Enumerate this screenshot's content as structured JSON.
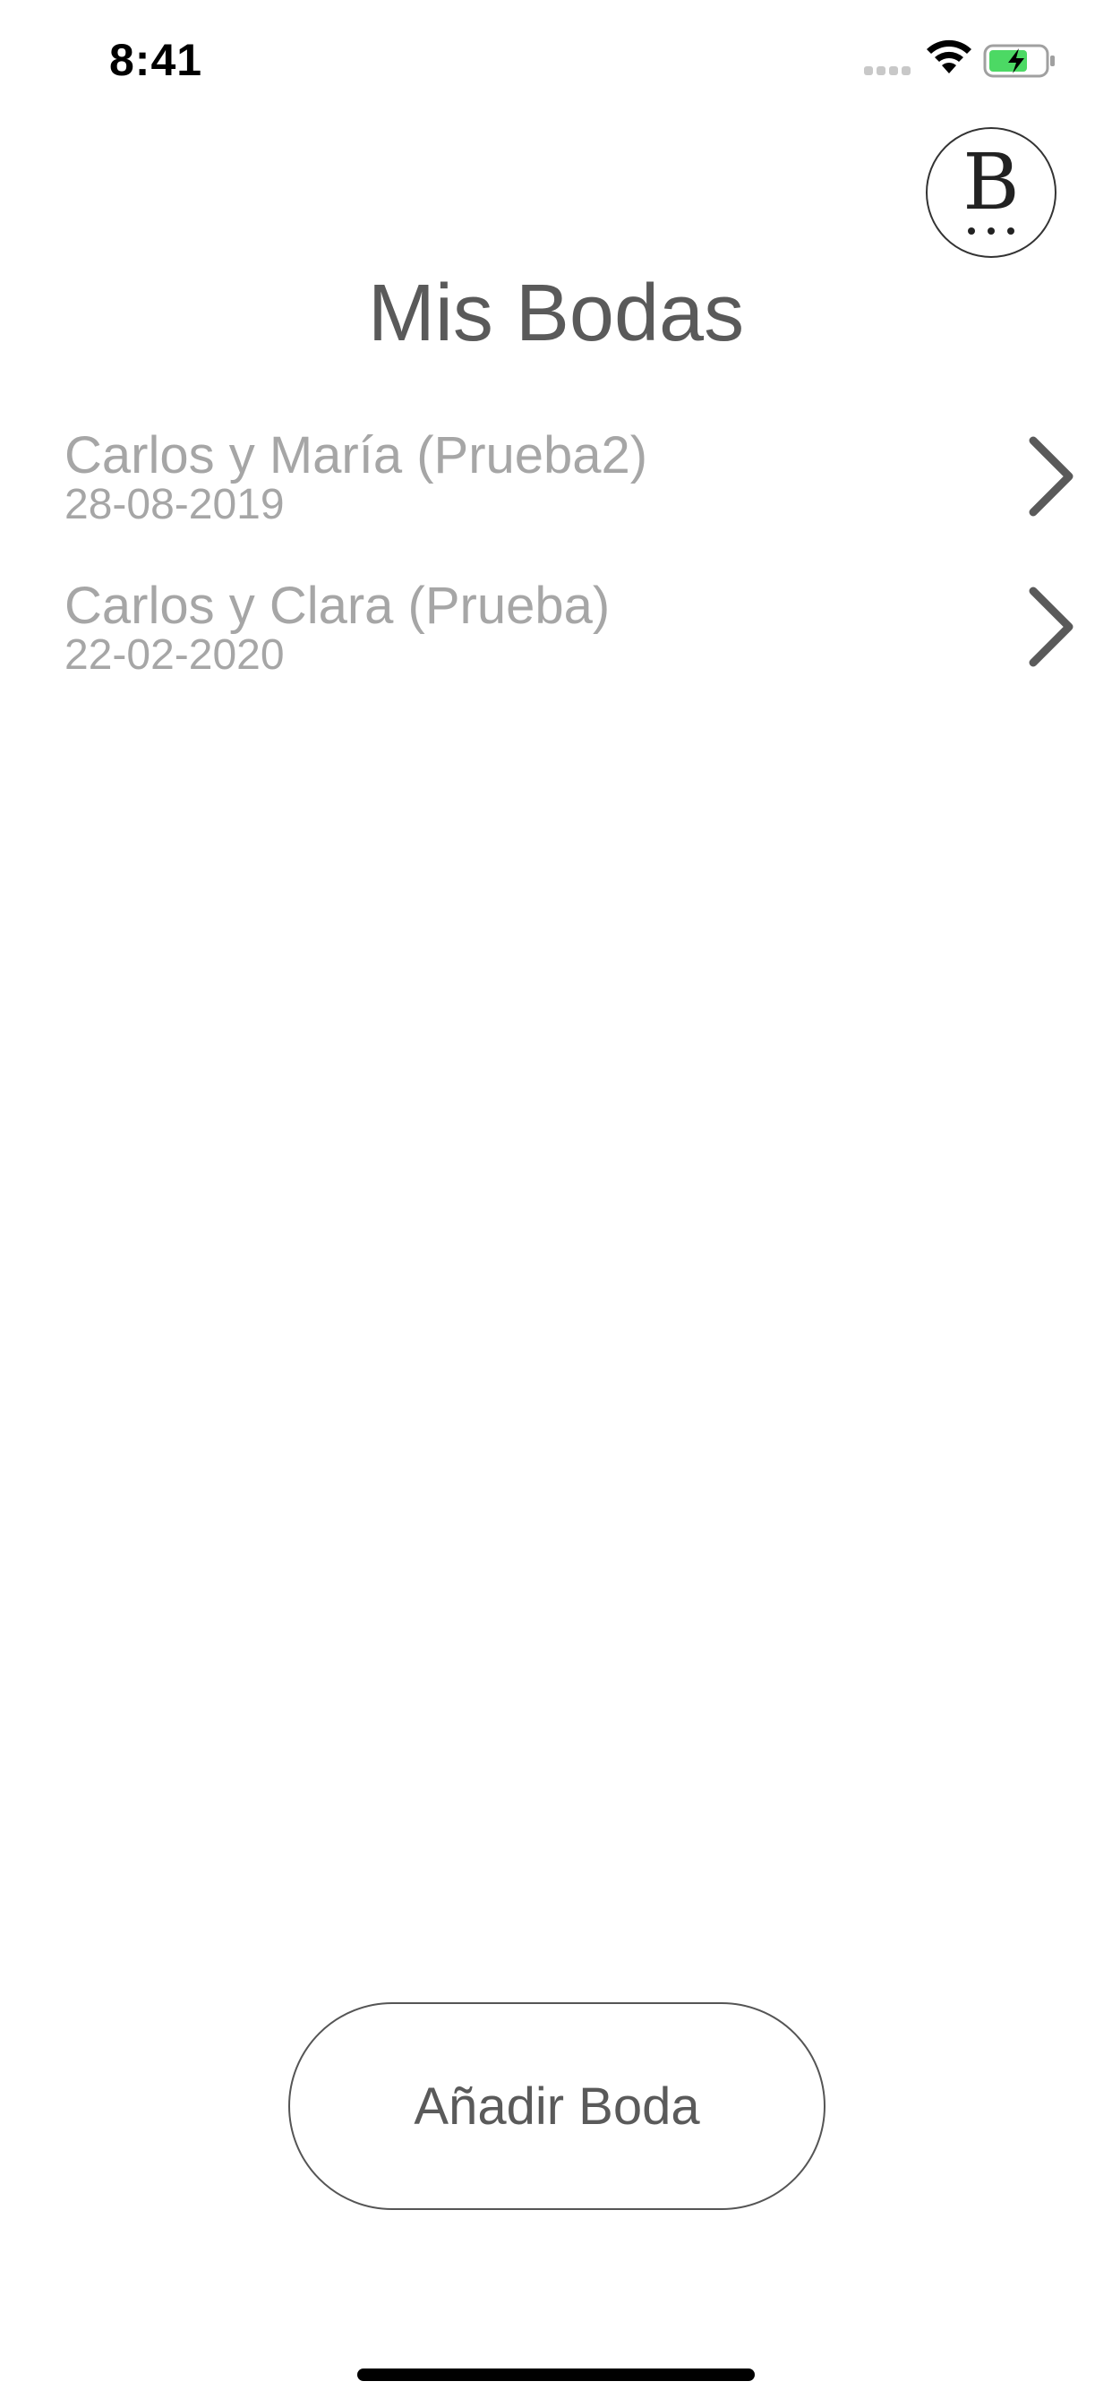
{
  "status_bar": {
    "time": "8:41"
  },
  "header": {
    "profile_letter": "B",
    "title": "Mis Bodas"
  },
  "weddings": [
    {
      "name": "Carlos y María (Prueba2)",
      "date": "28-08-2019"
    },
    {
      "name": "Carlos y Clara (Prueba)",
      "date": "22-02-2020"
    }
  ],
  "actions": {
    "add_label": "Añadir Boda"
  },
  "icons": {
    "wifi": "wifi-icon",
    "battery": "battery-charging-icon",
    "chevron": "chevron-right-icon"
  },
  "colors": {
    "title": "#5a5a5a",
    "list_text": "#a6a6a6",
    "battery_fill": "#4cd964"
  }
}
